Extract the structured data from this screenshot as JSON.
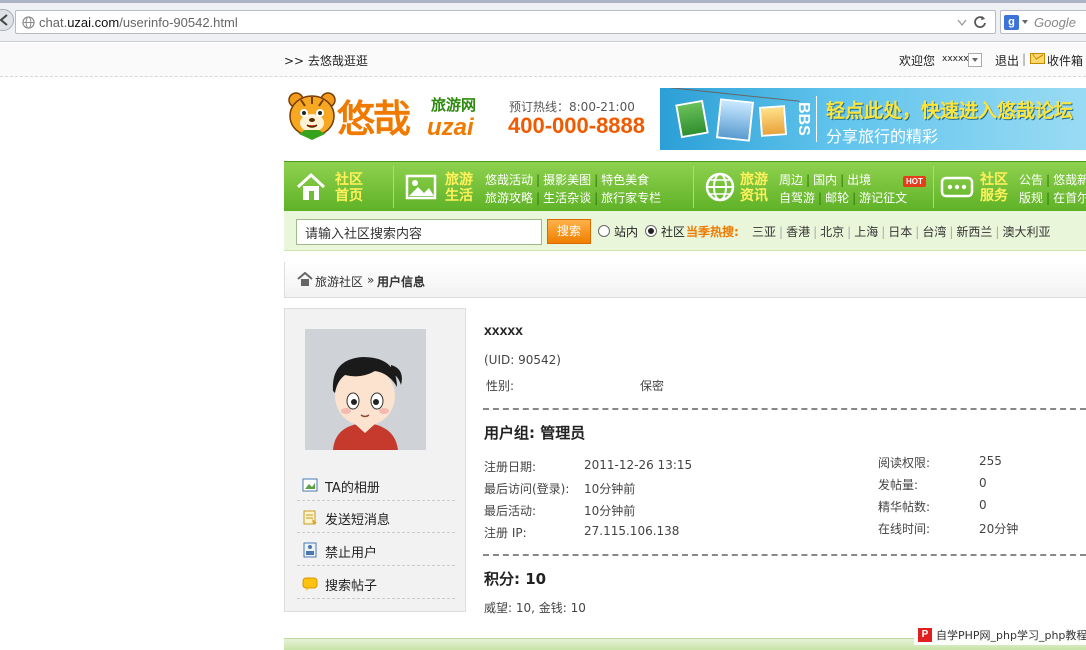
{
  "browser": {
    "url_prefix": "chat.",
    "url_domain": "uzai.com",
    "url_path": "/userinfo-90542.html",
    "search_placeholder": "Google",
    "search_logo": "g",
    "icons": {
      "back": "back-arrow-icon",
      "site": "globe-icon",
      "reload": "reload-icon",
      "dropdown": "chevron-down-icon"
    }
  },
  "topbar": {
    "go_link": ">> 去悠哉逛逛",
    "welcome": "欢迎您",
    "username": "xxxxx",
    "logout": "退出",
    "separator": "|",
    "inbox": "收件箱"
  },
  "header": {
    "logo_cn": "悠哉",
    "logo_sub": "旅游网",
    "logo_en": "uzai",
    "hotline_label": "预订热线：8:00-21:00",
    "hotline_number": "400-000-8888",
    "banner": {
      "bbs": "BBS",
      "cta": "轻点此处，快速进入悠哉论坛",
      "sub": "分享旅行的精彩"
    }
  },
  "nav": {
    "sections": [
      {
        "title": "社区首页",
        "icon": "home-icon",
        "links": []
      },
      {
        "title": "旅游生活",
        "icon": "photo-icon",
        "links": [
          [
            "悠哉活动",
            "摄影美图",
            "特色美食"
          ],
          [
            "旅游攻略",
            "生活杂谈",
            "旅行家专栏"
          ]
        ]
      },
      {
        "title": "旅游资讯",
        "icon": "globe-icon",
        "links": [
          [
            "周边",
            "国内",
            "出境"
          ],
          [
            "自驾游",
            "邮轮",
            "游记征文"
          ]
        ]
      },
      {
        "title": "社区服务",
        "icon": "chat-icon",
        "links": [
          [
            "公告",
            "悠哉新"
          ],
          [
            "版规",
            "在首尔"
          ]
        ]
      }
    ],
    "hot_badge": "HOT"
  },
  "search": {
    "placeholder": "请输入社区搜索内容",
    "button": "搜索",
    "scope_site": "站内",
    "scope_community": "社区",
    "selected_scope": "社区",
    "hot_label": "当季热搜:",
    "hot_words": [
      "三亚",
      "香港",
      "北京",
      "上海",
      "日本",
      "台湾",
      "新西兰",
      "澳大利亚"
    ]
  },
  "breadcrumb": {
    "home": "旅游社区",
    "separator": "»",
    "current": "用户信息"
  },
  "sidebar": {
    "items": [
      {
        "label": "TA的相册",
        "icon": "album-icon"
      },
      {
        "label": "发送短消息",
        "icon": "message-icon"
      },
      {
        "label": "禁止用户",
        "icon": "ban-user-icon"
      },
      {
        "label": "搜索帖子",
        "icon": "search-posts-icon"
      }
    ]
  },
  "profile": {
    "name": "xxxxx",
    "uid": "(UID: 90542)",
    "gender_label": "性别:",
    "gender_value": "保密",
    "group": "用户组: 管理员",
    "left_stats": [
      {
        "label": "注册日期:",
        "value": "2011-12-26 13:15"
      },
      {
        "label": "最后访问(登录):",
        "value": "10分钟前"
      },
      {
        "label": "最后活动:",
        "value": "10分钟前"
      },
      {
        "label": "注册 IP:",
        "value": "27.115.106.138"
      }
    ],
    "right_stats": [
      {
        "label": "阅读权限:",
        "value": "255"
      },
      {
        "label": "发帖量:",
        "value": "0"
      },
      {
        "label": "精华帖数:",
        "value": "0"
      },
      {
        "label": "在线时间:",
        "value": "20分钟"
      }
    ],
    "score": "积分: 10",
    "credits": "威望: 10, 金钱: 10"
  },
  "watermark": {
    "icon": "P",
    "text": "自学PHP网_php学习_php教程"
  },
  "colors": {
    "brand_orange": "#f07a00",
    "nav_green": "#5fb227",
    "hot_red": "#e53c1a"
  }
}
